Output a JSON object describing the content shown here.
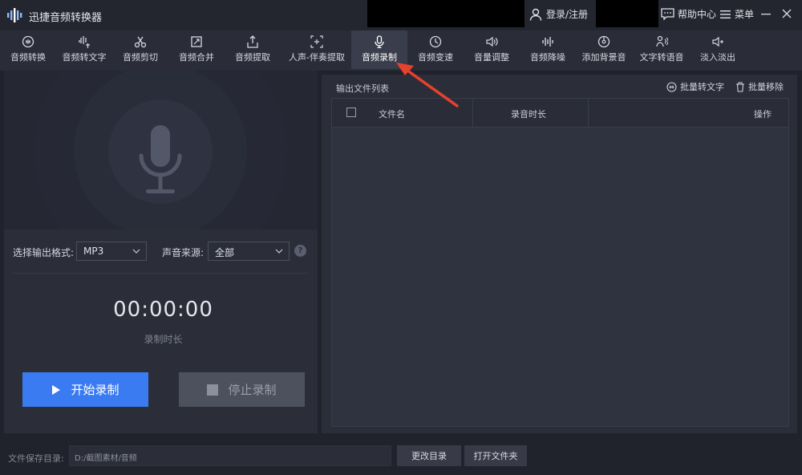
{
  "app": {
    "title": "迅捷音频转换器",
    "login_label": "登录/注册",
    "help_label": "帮助中心",
    "menu_label": "菜单"
  },
  "toolbar": {
    "items": [
      {
        "label": "音频转换",
        "icon": "audio-convert-icon"
      },
      {
        "label": "音频转文字",
        "icon": "audio-to-text-icon"
      },
      {
        "label": "音频剪切",
        "icon": "scissors-icon"
      },
      {
        "label": "音频合并",
        "icon": "merge-icon"
      },
      {
        "label": "音频提取",
        "icon": "extract-icon"
      },
      {
        "label": "人声-伴奏提取",
        "icon": "vocal-extract-icon"
      },
      {
        "label": "音频录制",
        "icon": "microphone-icon",
        "active": true
      },
      {
        "label": "音频变速",
        "icon": "clock-icon"
      },
      {
        "label": "音量调整",
        "icon": "volume-icon"
      },
      {
        "label": "音频降噪",
        "icon": "waveform-icon"
      },
      {
        "label": "添加背景音",
        "icon": "disc-icon"
      },
      {
        "label": "文字转语音",
        "icon": "text-speech-icon"
      },
      {
        "label": "淡入淡出",
        "icon": "fade-icon"
      }
    ]
  },
  "recorder": {
    "format_label": "选择输出格式:",
    "format_value": "MP3",
    "source_label": "声音来源:",
    "source_value": "全部",
    "help_glyph": "?",
    "timer": "00:00:00",
    "timer_label": "录制时长",
    "start_label": "开始录制",
    "stop_label": "停止录制"
  },
  "output": {
    "title": "输出文件列表",
    "batch_text_label": "批量转文字",
    "batch_remove_label": "批量移除",
    "columns": [
      "文件名",
      "录音时长",
      "操作"
    ]
  },
  "footer": {
    "save_dir_label": "文件保存目录:",
    "save_dir_value": "D:/截图素材/音频",
    "change_dir_label": "更改目录",
    "open_folder_label": "打开文件夹"
  },
  "colors": {
    "accent": "#3b7bf2",
    "annotation": "#e8412c",
    "background": "#20232c"
  }
}
